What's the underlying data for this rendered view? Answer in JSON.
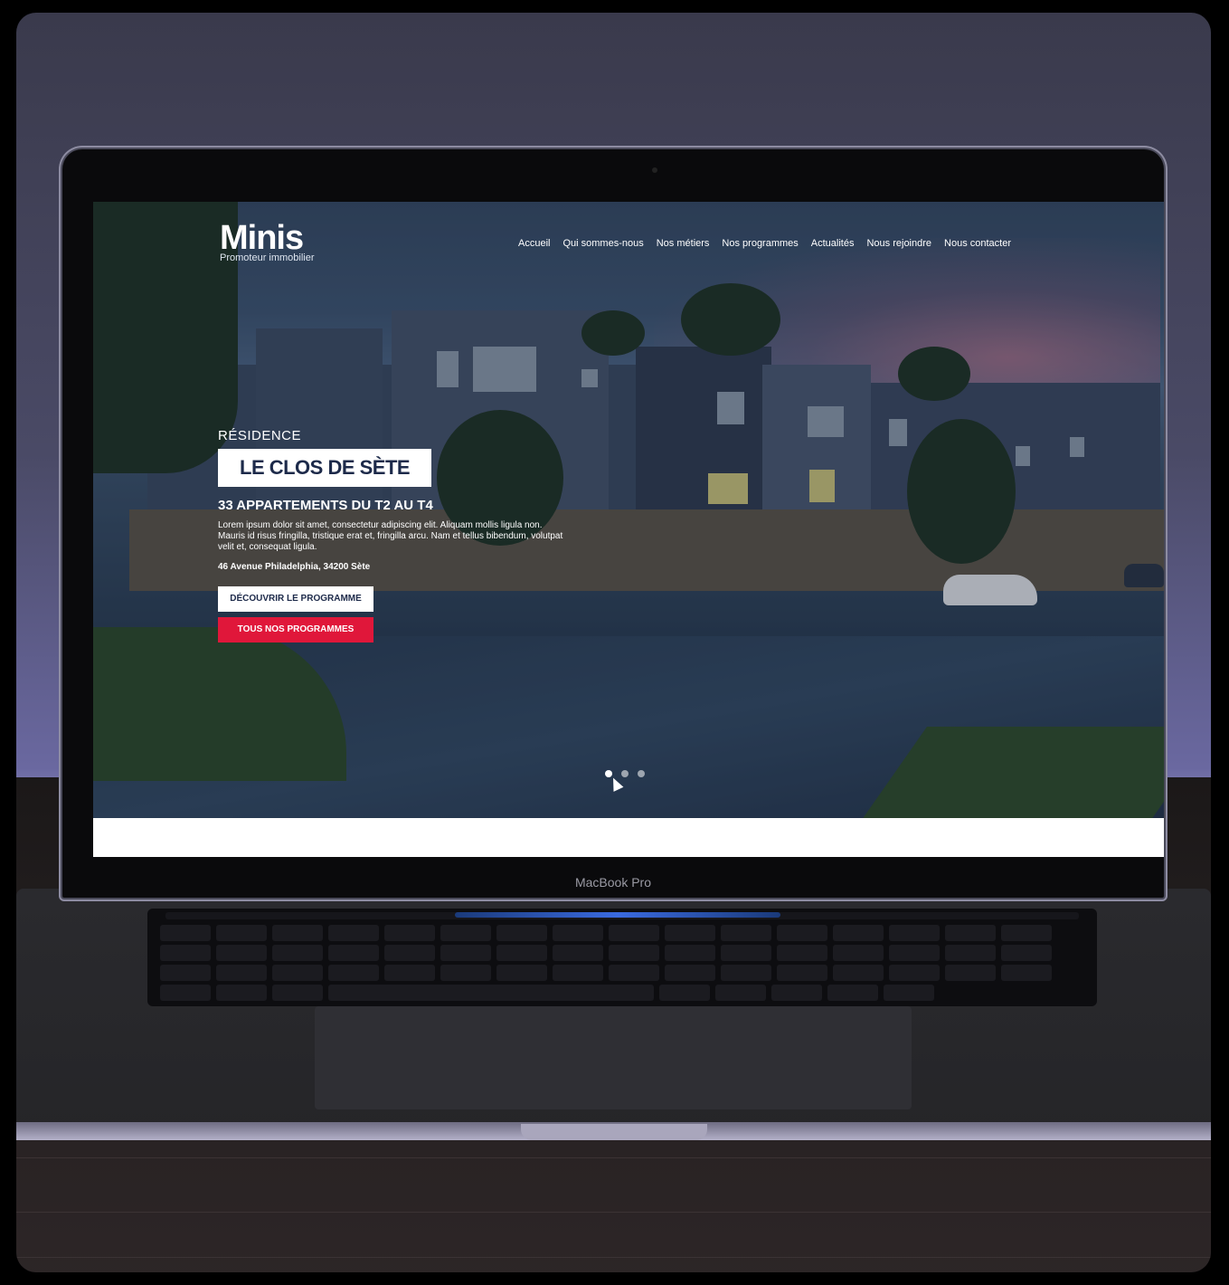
{
  "laptop": {
    "brand_label": "MacBook Pro"
  },
  "site": {
    "logo": {
      "name": "Minis",
      "tagline": "Promoteur immobilier"
    },
    "nav": [
      {
        "label": "Accueil"
      },
      {
        "label": "Qui sommes-nous"
      },
      {
        "label": "Nos métiers"
      },
      {
        "label": "Nos programmes"
      },
      {
        "label": "Actualités"
      },
      {
        "label": "Nous rejoindre"
      },
      {
        "label": "Nous contacter"
      }
    ],
    "hero": {
      "kicker": "RÉSIDENCE",
      "title": "LE CLOS DE SÈTE",
      "subtitle": "33 APPARTEMENTS DU T2 AU T4",
      "description": "Lorem ipsum dolor sit amet, consectetur adipiscing elit. Aliquam mollis ligula non. Mauris id risus fringilla, tristique erat et, fringilla arcu. Nam et tellus bibendum, volutpat velit et, consequat ligula.",
      "address": "46 Avenue Philadelphia, 34200 Sète",
      "primary_button": "DÉCOUVRIR LE PROGRAMME",
      "secondary_button": "TOUS NOS PROGRAMMES"
    },
    "carousel": {
      "total_slides": 3,
      "active_index": 0
    },
    "colors": {
      "accent_red": "#e0173a",
      "navy": "#1d2a4a"
    }
  }
}
